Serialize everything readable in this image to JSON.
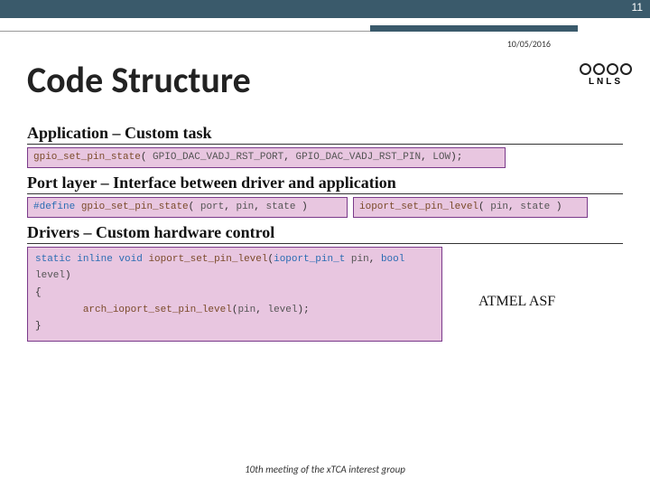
{
  "page_number": "11",
  "date": "10/05/2016",
  "title": "Code Structure",
  "logo": {
    "text": "LNLS",
    "sub": ""
  },
  "sections": {
    "app": {
      "heading": "Application – Custom task",
      "code_html": "<span class='cw-func'>gpio_set_pin_state</span>( <span class='cw-param'>GPIO_DAC_VADJ_RST_PORT</span>, <span class='cw-param'>GPIO_DAC_VADJ_RST_PIN</span>, <span class='cw-param'>LOW</span>);"
    },
    "port": {
      "heading": "Port layer – Interface between driver and application",
      "left_html": "<span class='cw-keyword'>#define</span> <span class='cw-func'>gpio_set_pin_state</span>( <span class='cw-param'>port</span>, <span class='cw-param'>pin</span>, <span class='cw-param'>state</span> )",
      "right_html": "<span class='cw-func'>ioport_set_pin_level</span>( <span class='cw-param'>pin</span>, <span class='cw-param'>state</span> )"
    },
    "drivers": {
      "heading": "Drivers – Custom hardware control",
      "code_html": "<span class='cw-keyword'>static</span> <span class='cw-keyword'>inline</span> <span class='cw-type'>void</span> <span class='cw-func'>ioport_set_pin_level</span>(<span class='cw-type'>ioport_pin_t</span> <span class='cw-param'>pin</span>, <span class='cw-type'>bool</span> <span class='cw-param'>level</span>)<br>{<br>&nbsp;&nbsp;&nbsp;&nbsp;&nbsp;&nbsp;&nbsp;&nbsp;<span class='cw-func'>arch_ioport_set_pin_level</span>(<span class='cw-param'>pin</span>, <span class='cw-param'>level</span>);<br>}"
    }
  },
  "aside": "ATMEL ASF",
  "footer": "10th meeting of the xTCA interest group"
}
